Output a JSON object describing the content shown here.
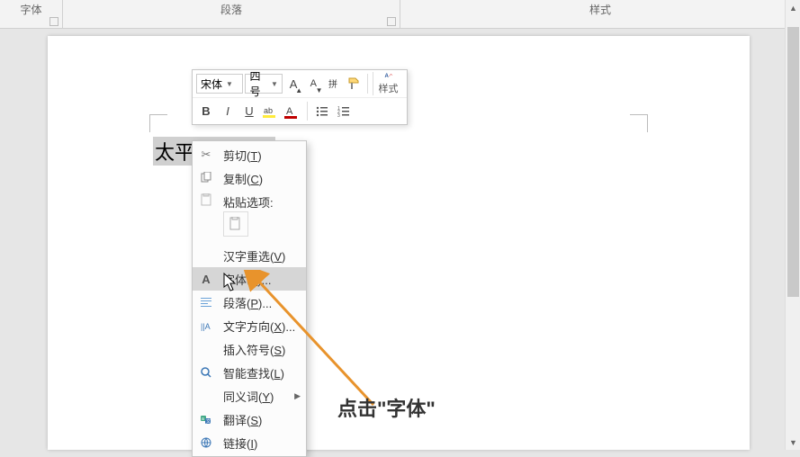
{
  "ribbon": {
    "groups": [
      "字体",
      "段落",
      "样式"
    ]
  },
  "document": {
    "selected_text": "太平洋电脑网"
  },
  "mini_toolbar": {
    "font_name": "宋体",
    "font_size": "四号",
    "styles_label": "样式"
  },
  "context_menu": {
    "items": [
      {
        "icon": "cut",
        "label": "剪切",
        "accel": "T"
      },
      {
        "icon": "copy",
        "label": "复制",
        "accel": "C"
      },
      {
        "icon": "paste",
        "label": "粘贴选项:",
        "accel": "",
        "group": true
      },
      {
        "icon": "",
        "label": "汉字重选",
        "accel": "V"
      },
      {
        "icon": "font",
        "label": "字体",
        "accel": "F",
        "highlight": true
      },
      {
        "icon": "paragraph",
        "label": "段落",
        "accel": "P"
      },
      {
        "icon": "textdir",
        "label": "文字方向",
        "accel": "X",
        "ellipsis": true
      },
      {
        "icon": "",
        "label": "插入符号",
        "accel": "S"
      },
      {
        "icon": "search",
        "label": "智能查找",
        "accel": "L"
      },
      {
        "icon": "",
        "label": "同义词",
        "accel": "Y",
        "submenu": true
      },
      {
        "icon": "translate",
        "label": "翻译",
        "accel": "S"
      },
      {
        "icon": "link",
        "label": "链接",
        "accel": "I"
      }
    ]
  },
  "annotation": {
    "callout": "点击\"字体\""
  }
}
